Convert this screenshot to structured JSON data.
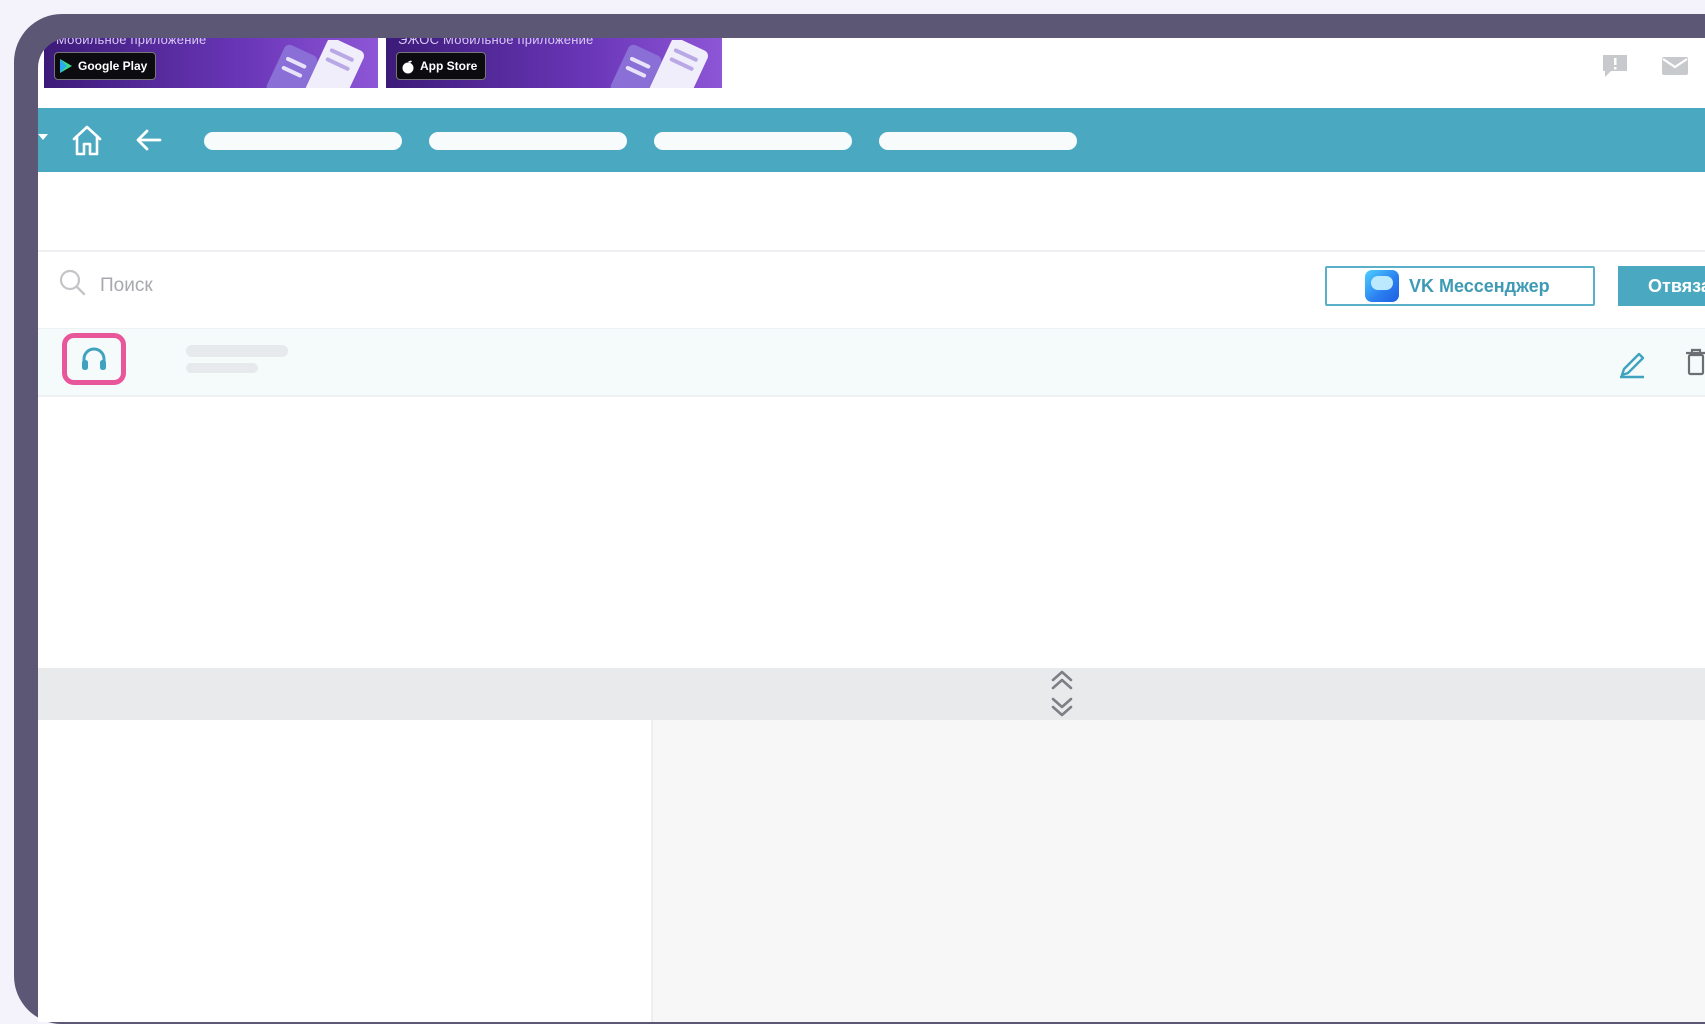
{
  "banners": [
    {
      "title": "Мобильное приложение",
      "store_label": "Google Play"
    },
    {
      "title": "ЭЖОС Мобильное приложение",
      "store_label": "App Store"
    }
  ],
  "top_icons": [
    "feedback-icon",
    "mail-icon"
  ],
  "navbar": {
    "home_icon": "home-icon",
    "back_icon": "arrow-left-icon",
    "pills_count_visible": 4
  },
  "search": {
    "placeholder": "Поиск",
    "value": ""
  },
  "actions": {
    "vk_messenger_label": "VK Мессенджер",
    "unlink_label": "Отвязат"
  },
  "list": {
    "rows": [
      {
        "icon": "headset-icon",
        "highlighted": true,
        "highlight_color": "#e8579a"
      }
    ]
  },
  "colors": {
    "accent": "#4aa8c0",
    "highlight": "#e8579a",
    "device_frame": "#5b5775"
  }
}
